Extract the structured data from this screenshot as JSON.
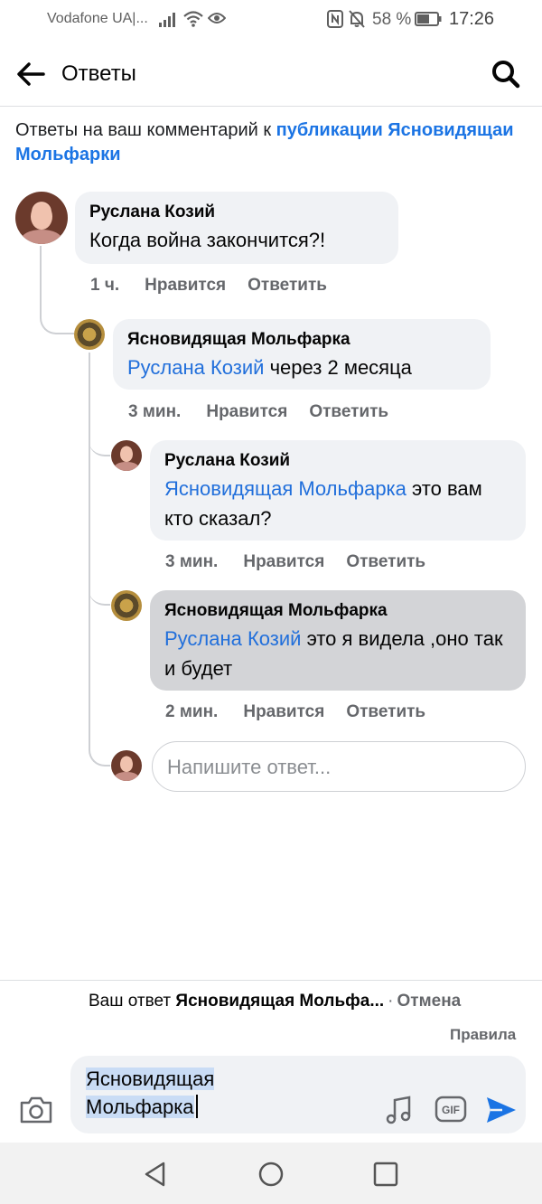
{
  "status_bar": {
    "carrier": "Vodafone UA|...",
    "battery": "58 %",
    "time": "17:26",
    "icons": [
      "signal-icon",
      "wifi-icon",
      "eye-icon",
      "nfc-icon",
      "mute-icon",
      "battery-icon"
    ]
  },
  "header": {
    "title": "Ответы",
    "back_icon": "arrow-left-icon",
    "search_icon": "search-icon"
  },
  "intro": {
    "prefix": "Ответы на ваш комментарий к ",
    "link": "публикации Ясновидящаи Мольфарки"
  },
  "comments": [
    {
      "author": "Руслана Козий",
      "mention": "",
      "text": "Когда война закончится?!",
      "time": "1 ч.",
      "like": "Нравится",
      "reply": "Ответить"
    },
    {
      "author": "Ясновидящая Мольфарка",
      "mention": "Руслана Козий",
      "text": " через 2 месяца",
      "time": "3 мин.",
      "like": "Нравится",
      "reply": "Ответить"
    },
    {
      "author": "Руслана Козий",
      "mention": "Ясновидящая Мольфарка",
      "text": " это вам кто сказал?",
      "time": "3 мин.",
      "like": "Нравится",
      "reply": "Ответить"
    },
    {
      "author": "Ясновидящая Мольфарка",
      "mention": "Руслана Козий",
      "text": " это я видела ,оно так и будет",
      "time": "2 мин.",
      "like": "Нравится",
      "reply": "Ответить"
    }
  ],
  "reply_input": {
    "placeholder": "Напишите ответ..."
  },
  "composer": {
    "reply_prefix": "Ваш ответ ",
    "reply_target": "Ясновидящая Мольфа...",
    "separator": "·",
    "cancel": "Отмена",
    "rules": "Правила",
    "text": "Ясновидящая Мольфарка",
    "icons": [
      "camera-icon",
      "music-icon",
      "gif-icon",
      "send-icon"
    ]
  },
  "colors": {
    "link": "#1b74e4",
    "mention": "#216fdb",
    "bubble": "#f0f2f5",
    "selected_bubble": "#d3d4d7",
    "meta": "#65676b"
  }
}
